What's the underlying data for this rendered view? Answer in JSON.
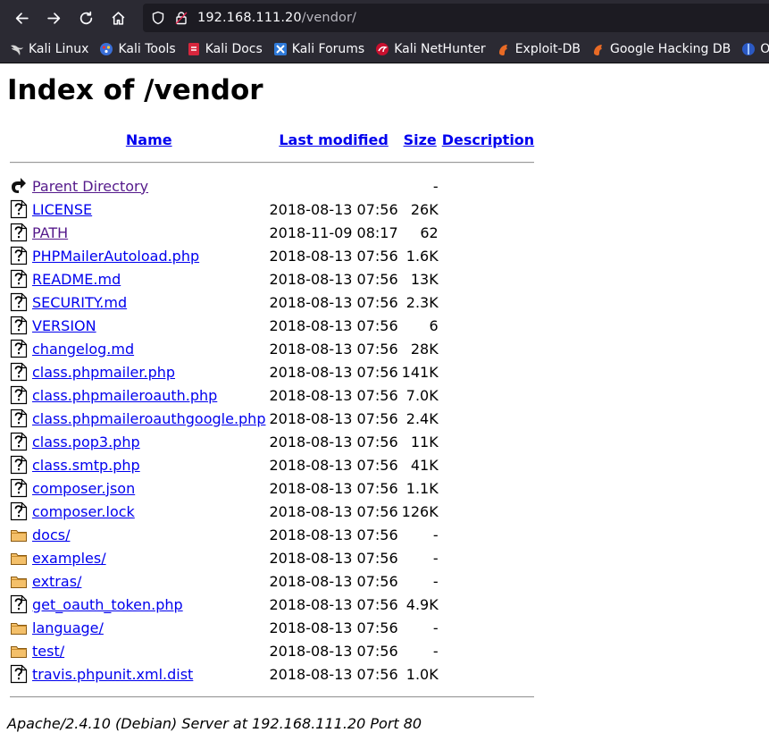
{
  "browser": {
    "url_host": "192.168.111.20",
    "url_path": "/vendor/",
    "bookmarks": [
      {
        "label": "Kali Linux",
        "icon": "kali-dragon-icon"
      },
      {
        "label": "Kali Tools",
        "icon": "kali-tools-icon"
      },
      {
        "label": "Kali Docs",
        "icon": "kali-docs-icon"
      },
      {
        "label": "Kali Forums",
        "icon": "kali-forums-icon"
      },
      {
        "label": "Kali NetHunter",
        "icon": "kali-nethunter-icon"
      },
      {
        "label": "Exploit-DB",
        "icon": "exploit-db-icon"
      },
      {
        "label": "Google Hacking DB",
        "icon": "ghdb-icon"
      },
      {
        "label": "OffSec",
        "icon": "offsec-icon"
      }
    ]
  },
  "page": {
    "title": "Index of /vendor",
    "columns": {
      "name": "Name",
      "last_modified": "Last modified",
      "size": "Size",
      "description": "Description"
    },
    "rows": [
      {
        "type": "back",
        "name": "Parent Directory",
        "date": "",
        "size": "-",
        "visited": true
      },
      {
        "type": "file",
        "name": "LICENSE",
        "date": "2018-08-13 07:56",
        "size": "26K",
        "visited": false
      },
      {
        "type": "file",
        "name": "PATH",
        "date": "2018-11-09 08:17",
        "size": "62",
        "visited": true
      },
      {
        "type": "file",
        "name": "PHPMailerAutoload.php",
        "date": "2018-08-13 07:56",
        "size": "1.6K",
        "visited": false
      },
      {
        "type": "file",
        "name": "README.md",
        "date": "2018-08-13 07:56",
        "size": "13K",
        "visited": false
      },
      {
        "type": "file",
        "name": "SECURITY.md",
        "date": "2018-08-13 07:56",
        "size": "2.3K",
        "visited": false
      },
      {
        "type": "file",
        "name": "VERSION",
        "date": "2018-08-13 07:56",
        "size": "6",
        "visited": false
      },
      {
        "type": "file",
        "name": "changelog.md",
        "date": "2018-08-13 07:56",
        "size": "28K",
        "visited": false
      },
      {
        "type": "file",
        "name": "class.phpmailer.php",
        "date": "2018-08-13 07:56",
        "size": "141K",
        "visited": false
      },
      {
        "type": "file",
        "name": "class.phpmaileroauth.php",
        "date": "2018-08-13 07:56",
        "size": "7.0K",
        "visited": false
      },
      {
        "type": "file",
        "name": "class.phpmaileroauthgoogle.php",
        "date": "2018-08-13 07:56",
        "size": "2.4K",
        "visited": false
      },
      {
        "type": "file",
        "name": "class.pop3.php",
        "date": "2018-08-13 07:56",
        "size": "11K",
        "visited": false
      },
      {
        "type": "file",
        "name": "class.smtp.php",
        "date": "2018-08-13 07:56",
        "size": "41K",
        "visited": false
      },
      {
        "type": "file",
        "name": "composer.json",
        "date": "2018-08-13 07:56",
        "size": "1.1K",
        "visited": false
      },
      {
        "type": "file",
        "name": "composer.lock",
        "date": "2018-08-13 07:56",
        "size": "126K",
        "visited": false
      },
      {
        "type": "folder",
        "name": "docs/",
        "date": "2018-08-13 07:56",
        "size": "-",
        "visited": false
      },
      {
        "type": "folder",
        "name": "examples/",
        "date": "2018-08-13 07:56",
        "size": "-",
        "visited": false
      },
      {
        "type": "folder",
        "name": "extras/",
        "date": "2018-08-13 07:56",
        "size": "-",
        "visited": false
      },
      {
        "type": "file",
        "name": "get_oauth_token.php",
        "date": "2018-08-13 07:56",
        "size": "4.9K",
        "visited": false
      },
      {
        "type": "folder",
        "name": "language/",
        "date": "2018-08-13 07:56",
        "size": "-",
        "visited": false
      },
      {
        "type": "folder",
        "name": "test/",
        "date": "2018-08-13 07:56",
        "size": "-",
        "visited": false
      },
      {
        "type": "file",
        "name": "travis.phpunit.xml.dist",
        "date": "2018-08-13 07:56",
        "size": "1.0K",
        "visited": false
      }
    ],
    "footer": "Apache/2.4.10 (Debian) Server at 192.168.111.20 Port 80"
  }
}
